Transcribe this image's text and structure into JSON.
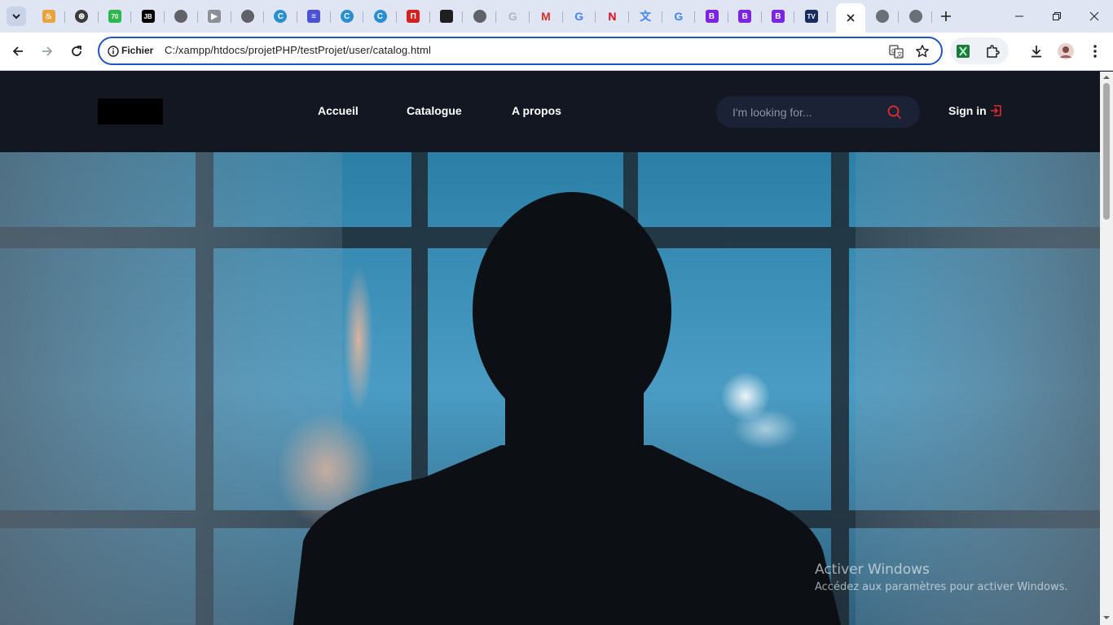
{
  "browser": {
    "tabs": [
      {
        "icon": "cursor-ai-icon",
        "color": "#e8a33d",
        "glyph": "♨"
      },
      {
        "icon": "chatgpt-icon",
        "color": "#3b3b3b",
        "glyph": "⊛"
      },
      {
        "icon": "counter-badge-icon",
        "color": "#2eb84c",
        "glyph": "70"
      },
      {
        "icon": "jetbrains-icon",
        "color": "#000000",
        "glyph": "JB"
      },
      {
        "icon": "globe-icon",
        "color": "#5f6368",
        "glyph": ""
      },
      {
        "icon": "youtube-icon",
        "color": "#8a8f98",
        "glyph": "▶"
      },
      {
        "icon": "globe-icon",
        "color": "#5f6368",
        "glyph": ""
      },
      {
        "icon": "copilot-icon",
        "color": "#2a8fd0",
        "glyph": "C"
      },
      {
        "icon": "chat-app-icon",
        "color": "#4a52d6",
        "glyph": "≡"
      },
      {
        "icon": "copilot-icon",
        "color": "#2a8fd0",
        "glyph": "C"
      },
      {
        "icon": "copilot-icon",
        "color": "#2a8fd0",
        "glyph": "C"
      },
      {
        "icon": "ucloud-icon",
        "color": "#d62020",
        "glyph": "Π"
      },
      {
        "icon": "github-icon",
        "color": "#1f1f1f",
        "glyph": ""
      },
      {
        "icon": "globe-icon",
        "color": "#5f6368",
        "glyph": ""
      },
      {
        "icon": "google-icon",
        "color": "#b0b6c0",
        "glyph": "G"
      },
      {
        "icon": "gmail-icon",
        "color": "#d93025",
        "glyph": "M"
      },
      {
        "icon": "google-icon",
        "color": "#4285f4",
        "glyph": "G"
      },
      {
        "icon": "netflix-icon",
        "color": "#e50914",
        "glyph": "N"
      },
      {
        "icon": "translate-icon",
        "color": "#4285f4",
        "glyph": "文"
      },
      {
        "icon": "google-icon",
        "color": "#4285f4",
        "glyph": "G"
      },
      {
        "icon": "bootstrap-icon",
        "color": "#7c24e3",
        "glyph": "B"
      },
      {
        "icon": "bootstrap-icon",
        "color": "#7c24e3",
        "glyph": "B"
      },
      {
        "icon": "bootstrap-icon",
        "color": "#7c24e3",
        "glyph": "B"
      },
      {
        "icon": "tv-icon",
        "color": "#1a2b5e",
        "glyph": "TV"
      }
    ],
    "trailing_tabs": [
      {
        "icon": "globe-icon",
        "color": "#5f6368"
      },
      {
        "icon": "globe-icon",
        "color": "#5f6368"
      }
    ],
    "address": {
      "chip": "Fichier",
      "url": "C:/xampp/htdocs/projetPHP/testProjet/user/catalog.html"
    }
  },
  "site": {
    "nav": {
      "home": "Accueil",
      "catalog": "Catalogue",
      "about": "A propos"
    },
    "search": {
      "placeholder": "I'm looking for..."
    },
    "signin": "Sign in",
    "accent": "#e52b2b",
    "header_bg": "#131722"
  },
  "watermark": {
    "title": "Activer Windows",
    "subtitle": "Accédez aux paramètres pour activer Windows."
  }
}
